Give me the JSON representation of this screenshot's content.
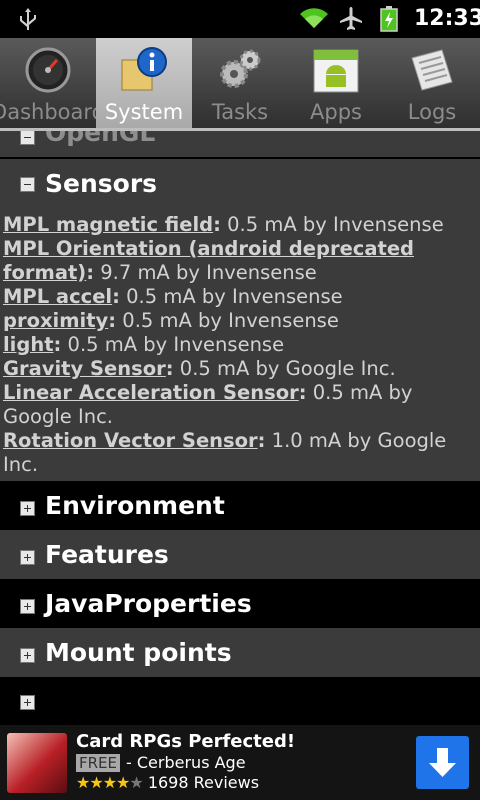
{
  "status_bar": {
    "time": "12:33"
  },
  "tabs": [
    {
      "label": "Dashboard",
      "icon": "gauge-icon",
      "active": false
    },
    {
      "label": "System",
      "icon": "info-icon",
      "active": true
    },
    {
      "label": "Tasks",
      "icon": "gears-icon",
      "active": false
    },
    {
      "label": "Apps",
      "icon": "android-icon",
      "active": false
    },
    {
      "label": "Logs",
      "icon": "document-icon",
      "active": false
    }
  ],
  "sections": {
    "top_partial": "OpenGL",
    "sensors_title": "Sensors",
    "environment": "Environment",
    "features": "Features",
    "java_properties": "JavaProperties",
    "mount_points": "Mount points",
    "bottom_partial": ""
  },
  "sensors": [
    {
      "name": "MPL magnetic field",
      "detail": " 0.5 mA by Invensense"
    },
    {
      "name": "MPL Orientation (android deprecated format)",
      "detail": " 9.7 mA by Invensense"
    },
    {
      "name": "MPL accel",
      "detail": " 0.5 mA by Invensense"
    },
    {
      "name": "proximity",
      "detail": " 0.5 mA by Invensense"
    },
    {
      "name": "light",
      "detail": " 0.5 mA by Invensense"
    },
    {
      "name": "Gravity Sensor",
      "detail": " 0.5 mA by Google Inc."
    },
    {
      "name": "Linear Acceleration Sensor",
      "detail": " 0.5 mA by Google Inc."
    },
    {
      "name": "Rotation Vector Sensor",
      "detail": " 1.0 mA by Google Inc."
    }
  ],
  "ad": {
    "title": "Card RPGs Perfected!",
    "free_badge": "FREE",
    "subtitle": "- Cerberus Age",
    "rating": 4,
    "stars_on": "★★★★",
    "stars_off": "★",
    "reviews": "1698 Reviews"
  }
}
